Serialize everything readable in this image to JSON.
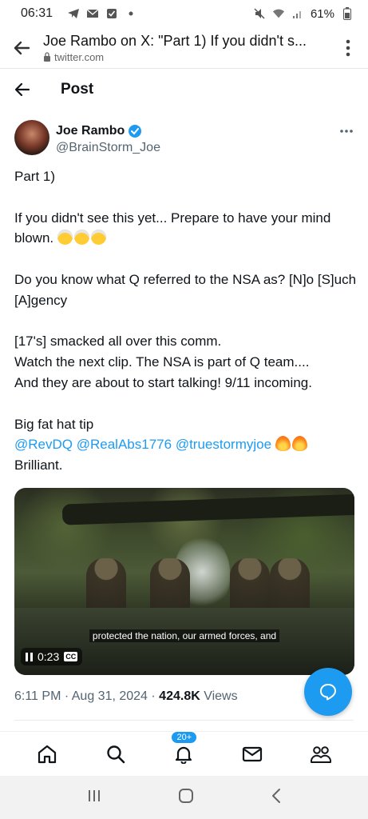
{
  "status_bar": {
    "time": "06:31",
    "battery": "61%"
  },
  "browser": {
    "page_title": "Joe Rambo on X: \"Part 1) If you didn't s...",
    "url": "twitter.com"
  },
  "header": {
    "title": "Post"
  },
  "author": {
    "name": "Joe Rambo",
    "handle": "@BrainStorm_Joe"
  },
  "tweet": {
    "p1": "Part 1)",
    "p2a": "If you didn't see this yet... Prepare to have your mind blown.",
    "p3": "Do you know what Q referred to the NSA as?  [N]o [S]uch [A]gency",
    "p4_l1": "[17's] smacked all over this comm.",
    "p4_l2": "Watch the next clip.   The NSA is part of Q team....",
    "p4_l3": "And they are about to start talking!     9/11 incoming.",
    "p5_l1": "Big fat hat tip",
    "mention1": "@RevDQ",
    "mention2": "@RealAbs1776",
    "mention3": "@truestormyjoe",
    "p5_l3": "Brilliant."
  },
  "video": {
    "caption": "protected the nation, our armed forces, and",
    "time": "0:23",
    "cc": "CC"
  },
  "meta": {
    "time": "6:11 PM",
    "date": "Aug 31, 2024",
    "views_count": "424.8K",
    "views_label": "Views"
  },
  "bottom_nav": {
    "notifications_badge": "20+"
  },
  "colors": {
    "accent": "#1d9bf0",
    "text": "#0f1419",
    "muted": "#536471"
  }
}
